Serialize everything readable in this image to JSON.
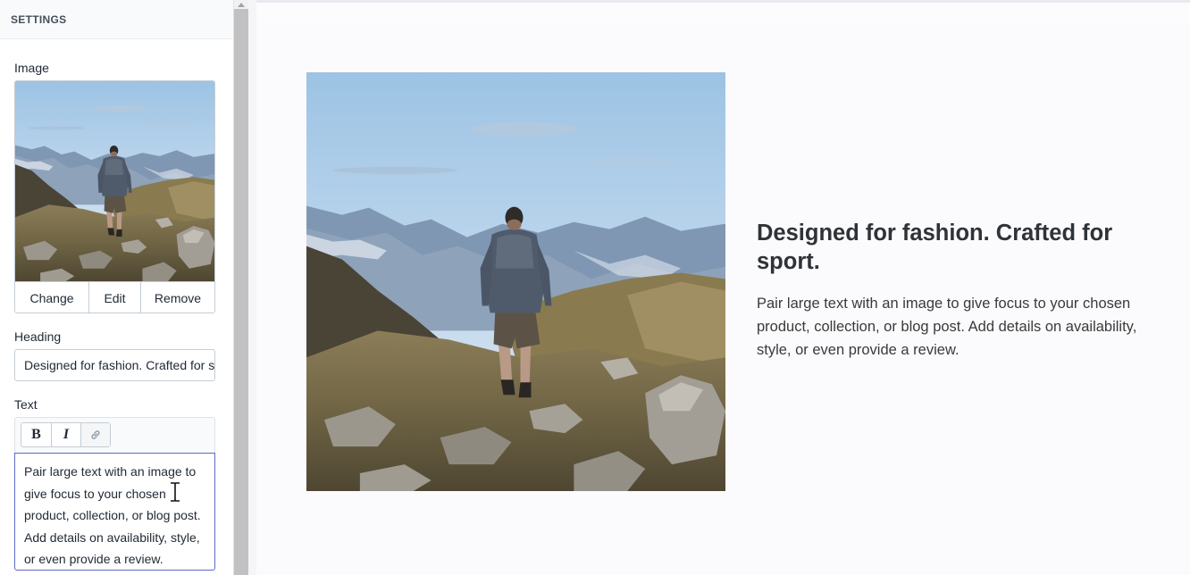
{
  "sidebar": {
    "title": "SETTINGS",
    "image_label": "Image",
    "image_actions": {
      "change": "Change",
      "edit": "Edit",
      "remove": "Remove"
    },
    "heading_label": "Heading",
    "heading_value": "Designed for fashion. Crafted for sport.",
    "text_label": "Text",
    "toolbar": {
      "bold": "B",
      "italic": "I",
      "link_icon": "link-icon"
    },
    "text_value": "Pair large text with an image to give focus to your chosen product, collection, or blog post. Add details on availability, style, or even provide a review."
  },
  "preview": {
    "heading": "Designed for fashion. Crafted for sport.",
    "text": "Pair large text with an image to give focus to your chosen product, collection, or blog post. Add details on availability, style, or even provide a review."
  },
  "colors": {
    "accent": "#5c6ac4",
    "border": "#c4cdd5",
    "text": "#212b36",
    "scrollbar": "#c1c1c1"
  }
}
